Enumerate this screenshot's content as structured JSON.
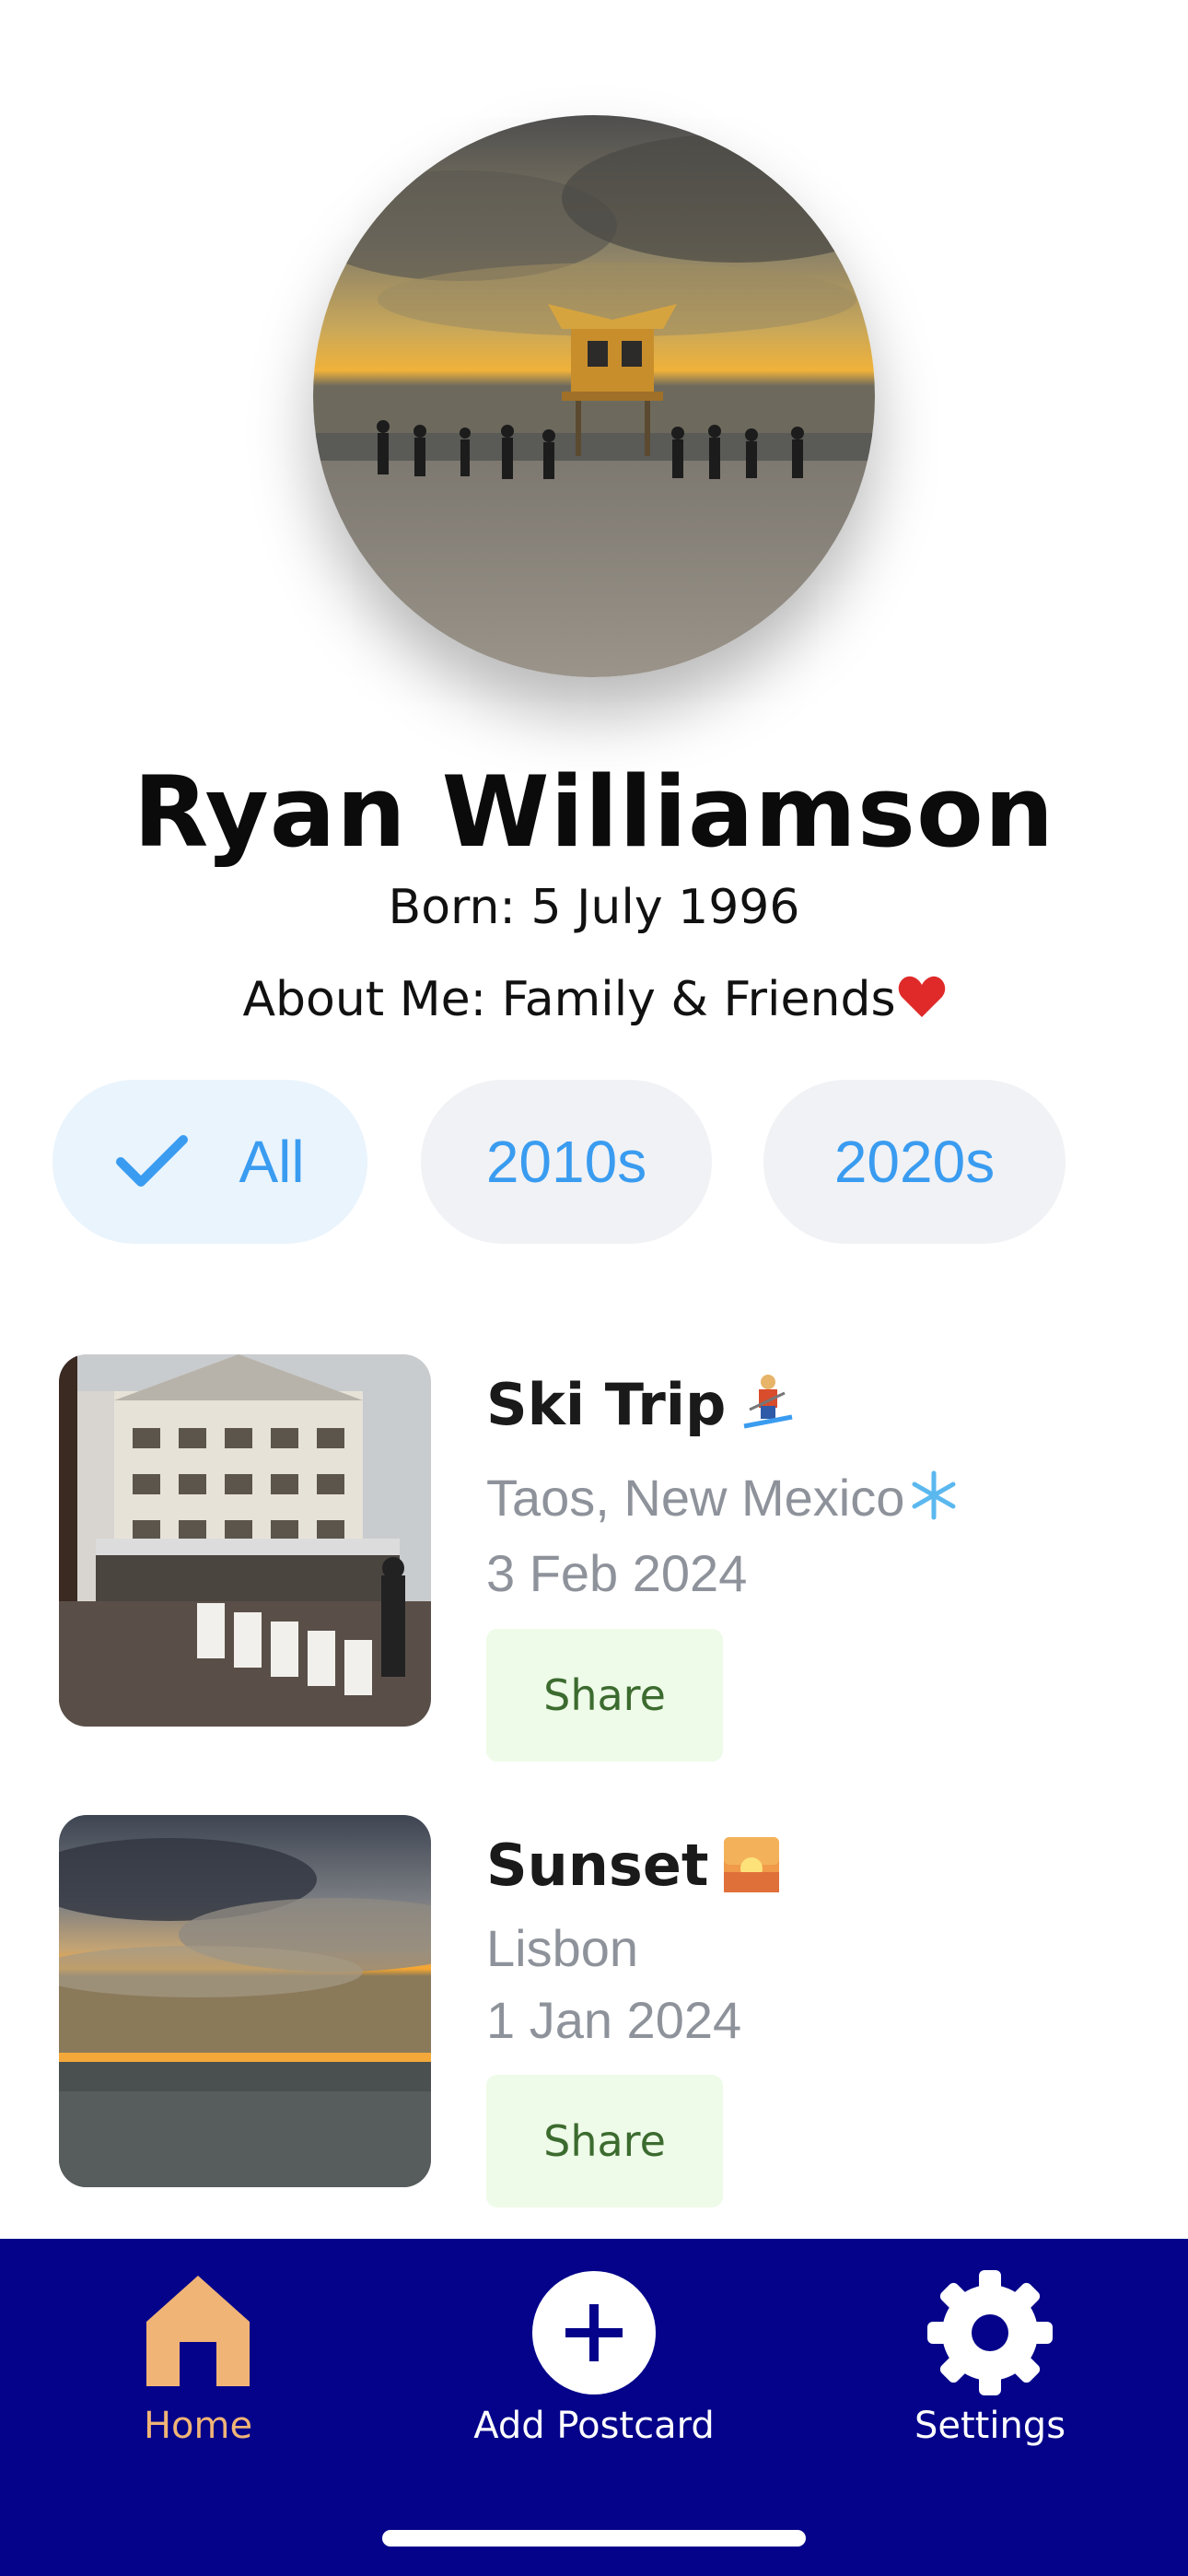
{
  "profile": {
    "name": "Ryan Williamson",
    "born": "Born: 5 July 1996",
    "about": "About Me: Family & Friends",
    "avatar_alt_icon": "beach-yoga-photo"
  },
  "filters": {
    "selected": "All",
    "items": [
      {
        "label": "All",
        "selected": true
      },
      {
        "label": "2010s",
        "selected": false
      },
      {
        "label": "2020s",
        "selected": false
      }
    ]
  },
  "postcards": [
    {
      "title": "Ski Trip",
      "title_emoji_icon": "skier-icon",
      "location": "Taos, New Mexico",
      "location_emoji_icon": "snowflake-icon",
      "date": "3 Feb 2024",
      "share_label": "Share",
      "photo_icon": "ski-lodge-photo"
    },
    {
      "title": "Sunset",
      "title_emoji_icon": "sunset-icon",
      "location": "Lisbon",
      "date": "1 Jan 2024",
      "share_label": "Share",
      "photo_icon": "ocean-sunset-photo"
    }
  ],
  "nav": {
    "items": [
      {
        "label": "Home",
        "icon": "home-icon",
        "active": true
      },
      {
        "label": "Add Postcard",
        "icon": "plus-circle-icon",
        "active": false
      },
      {
        "label": "Settings",
        "icon": "gear-icon",
        "active": false
      }
    ]
  },
  "colors": {
    "accent_blue": "#3a9cf0",
    "nav_background": "#04038a",
    "nav_active": "#f0b477",
    "share_bg": "#eefbe8",
    "share_text": "#3c6b2f"
  }
}
